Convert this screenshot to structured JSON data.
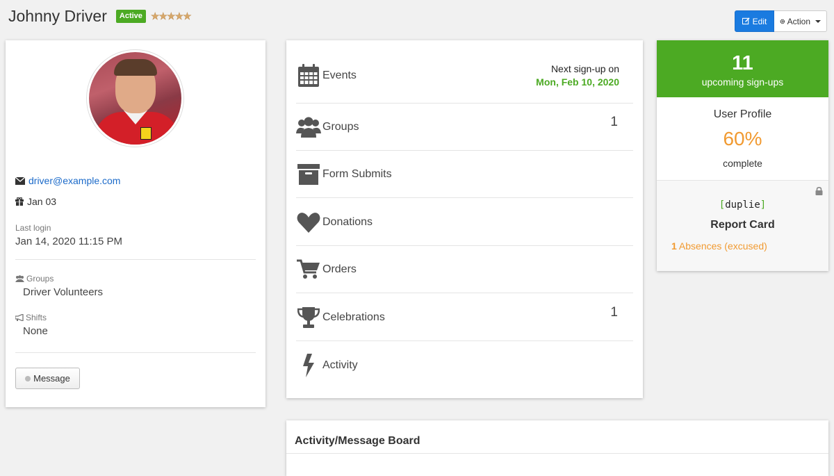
{
  "header": {
    "user_name": "Johnny Driver",
    "status": "Active",
    "rating_stars": "★★★★★"
  },
  "toolbar": {
    "edit_label": "Edit",
    "action_label": "Action"
  },
  "profile": {
    "email": "driver@example.com",
    "birthday": "Jan 03",
    "last_login_label": "Last login",
    "last_login_value": "Jan 14, 2020 11:15 PM",
    "groups_label": "Groups",
    "groups_value": "Driver Volunteers",
    "shifts_label": "Shifts",
    "shifts_value": "None",
    "message_button": "Message"
  },
  "menu": {
    "events": {
      "label": "Events",
      "next_label": "Next sign-up on",
      "next_date": "Mon, Feb 10, 2020"
    },
    "groups": {
      "label": "Groups",
      "count": "1"
    },
    "form_submits": {
      "label": "Form Submits"
    },
    "donations": {
      "label": "Donations"
    },
    "orders": {
      "label": "Orders"
    },
    "celebrations": {
      "label": "Celebrations",
      "count": "1"
    },
    "activity": {
      "label": "Activity"
    }
  },
  "stats": {
    "signup_count": "11",
    "signup_label": "upcoming sign-ups",
    "profile_title": "User Profile",
    "profile_percent": "60%",
    "profile_sub": "complete",
    "brand_open": "[",
    "brand_name": "duplie",
    "brand_close": "]",
    "report_card_title": "Report Card",
    "absences_count": "1",
    "absences_label": "Absences (excused)"
  },
  "board": {
    "title": "Activity/Message Board"
  },
  "colors": {
    "accent_green": "#4caa23",
    "accent_orange": "#f19a31",
    "primary_blue": "#1a7be0",
    "link_blue": "#1b6ac9"
  }
}
